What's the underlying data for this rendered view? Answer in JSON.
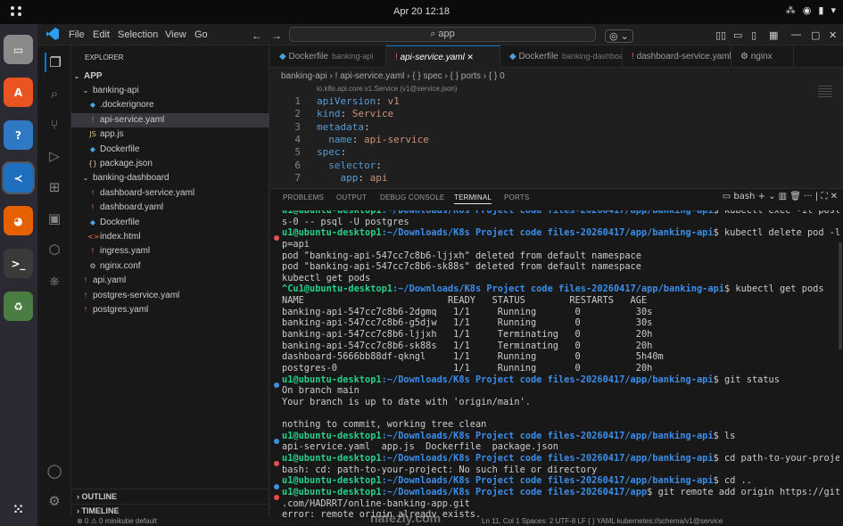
{
  "topbar": {
    "clock": "Apr 20  12:18",
    "tray": [
      "⁂",
      "◉",
      "▮",
      "▾"
    ]
  },
  "dock": [
    {
      "name": "files-icon",
      "glyph": "▭",
      "color": "#8a8a8a"
    },
    {
      "name": "app-center-icon",
      "glyph": "A",
      "color": "#e95420"
    },
    {
      "name": "help-icon",
      "glyph": "?",
      "color": "#2f78c4"
    },
    {
      "name": "vscode-icon",
      "glyph": "≺",
      "color": "#1e6fbf"
    },
    {
      "name": "firefox-icon",
      "glyph": "◕",
      "color": "#e66000"
    },
    {
      "name": "terminal-icon",
      "glyph": ">_",
      "color": "#3a3a3a"
    },
    {
      "name": "trash-icon",
      "glyph": "♻",
      "color": "#4a7d42"
    }
  ],
  "menu": [
    "File",
    "Edit",
    "Selection",
    "View",
    "Go"
  ],
  "cmd": "app",
  "explorer": {
    "title": "EXPLORER",
    "root": "APP",
    "outline": "OUTLINE",
    "timeline": "TIMELINE",
    "items": [
      {
        "label": "banking-api",
        "depth": 1,
        "icon": "⌄",
        "color": "#ccc"
      },
      {
        "label": ".dockerignore",
        "depth": 2,
        "icon": "◆",
        "color": "#4aa3df"
      },
      {
        "label": "api-service.yaml",
        "depth": 2,
        "icon": "!",
        "color": "#d35fa8",
        "sel": true
      },
      {
        "label": "app.js",
        "depth": 2,
        "icon": "JS",
        "color": "#e5c07b"
      },
      {
        "label": "Dockerfile",
        "depth": 2,
        "icon": "◆",
        "color": "#4aa3df"
      },
      {
        "label": "package.json",
        "depth": 2,
        "icon": "{}",
        "color": "#e5c07b"
      },
      {
        "label": "banking-dashboard",
        "depth": 1,
        "icon": "⌄",
        "color": "#ccc"
      },
      {
        "label": "dashboard-service.yaml",
        "depth": 2,
        "icon": "!",
        "color": "#d35fa8"
      },
      {
        "label": "dashboard.yaml",
        "depth": 2,
        "icon": "!",
        "color": "#d35fa8"
      },
      {
        "label": "Dockerfile",
        "depth": 2,
        "icon": "◆",
        "color": "#4aa3df"
      },
      {
        "label": "index.html",
        "depth": 2,
        "icon": "<>",
        "color": "#e37933"
      },
      {
        "label": "ingress.yaml",
        "depth": 2,
        "icon": "!",
        "color": "#d35fa8"
      },
      {
        "label": "nginx.conf",
        "depth": 2,
        "icon": "⚙",
        "color": "#bbb"
      },
      {
        "label": "api.yaml",
        "depth": 1,
        "icon": "!",
        "color": "#d35fa8"
      },
      {
        "label": "postgres-service.yaml",
        "depth": 1,
        "icon": "!",
        "color": "#d35fa8"
      },
      {
        "label": "postgres.yaml",
        "depth": 1,
        "icon": "!",
        "color": "#d35fa8"
      }
    ]
  },
  "tabs": [
    {
      "label": "Dockerfile",
      "desc": "banking-api",
      "active": false
    },
    {
      "label": "api-service.yaml",
      "desc": "",
      "active": true
    },
    {
      "label": "Dockerfile",
      "desc": "banking-dashboard",
      "active": false
    },
    {
      "label": "dashboard-service.yaml",
      "desc": "",
      "active": false
    },
    {
      "label": "nginx",
      "desc": "",
      "active": false
    }
  ],
  "breadcrumb": "banking-api  ›  !  api-service.yaml  ›  { } spec  ›  { } ports  ›  { } 0",
  "codelens": "io.k8s.api.core.v1.Service (v1@service.json)",
  "code": [
    {
      "n": "1",
      "k": "apiVersion",
      "v": " v1",
      "indent": ""
    },
    {
      "n": "2",
      "k": "kind",
      "v": " Service",
      "indent": ""
    },
    {
      "n": "3",
      "k": "metadata",
      "v": "",
      "indent": ""
    },
    {
      "n": "4",
      "k": "name",
      "v": " api-service",
      "indent": "  "
    },
    {
      "n": "5",
      "k": "spec",
      "v": "",
      "indent": ""
    },
    {
      "n": "6",
      "k": "selector",
      "v": "",
      "indent": "  "
    },
    {
      "n": "7",
      "k": "app",
      "v": " api",
      "indent": "    "
    }
  ],
  "panel_tabs": [
    "PROBLEMS",
    "OUTPUT",
    "DEBUG CONSOLE",
    "TERMINAL",
    "PORTS"
  ],
  "panel_tools": "▭ bash  + ⌄  ▥  🗑  ···  |  ⛶  ✕",
  "terminal": [
    {
      "type": "cmd",
      "dot": "",
      "user": "u1@ubuntu-desktop1",
      "path": ":~/Downloads/K8s Project code files-20260417/app/banking-api",
      "rest": "$ kubectl exec -it postgre"
    },
    {
      "type": "out",
      "text": "s-0 -- psql -U postgres"
    },
    {
      "type": "cmd",
      "dot": "#f14c4c",
      "user": "u1@ubuntu-desktop1",
      "path": ":~/Downloads/K8s Project code files-20260417/app/banking-api",
      "rest": "$ kubectl delete pod -l ap"
    },
    {
      "type": "out",
      "text": "p=api"
    },
    {
      "type": "out",
      "text": "pod \"banking-api-547cc7c8b6-ljjxh\" deleted from default namespace"
    },
    {
      "type": "out",
      "text": "pod \"banking-api-547cc7c8b6-sk88s\" deleted from default namespace"
    },
    {
      "type": "out",
      "text": "kubectl get pods"
    },
    {
      "type": "cmd",
      "dot": "",
      "user": "^Cu1@ubuntu-desktop1",
      "path": ":~/Downloads/K8s Project code files-20260417/app/banking-api",
      "rest": "$ kubectl get pods"
    },
    {
      "type": "out",
      "text": "NAME                          READY   STATUS        RESTARTS   AGE"
    },
    {
      "type": "out",
      "text": "banking-api-547cc7c8b6-2dgmq   1/1     Running       0          30s"
    },
    {
      "type": "out",
      "text": "banking-api-547cc7c8b6-g5djw   1/1     Running       0          30s"
    },
    {
      "type": "out",
      "text": "banking-api-547cc7c8b6-ljjxh   1/1     Terminating   0          20h"
    },
    {
      "type": "out",
      "text": "banking-api-547cc7c8b6-sk88s   1/1     Terminating   0          20h"
    },
    {
      "type": "out",
      "text": "dashboard-5666bb88df-qkngl     1/1     Running       0          5h40m"
    },
    {
      "type": "out",
      "text": "postgres-0                     1/1     Running       0          20h"
    },
    {
      "type": "cmd",
      "dot": "#3b8eea",
      "user": "u1@ubuntu-desktop1",
      "path": ":~/Downloads/K8s Project code files-20260417/app/banking-api",
      "rest": "$ git status"
    },
    {
      "type": "out",
      "text": "On branch main"
    },
    {
      "type": "out",
      "text": "Your branch is up to date with 'origin/main'."
    },
    {
      "type": "out",
      "text": ""
    },
    {
      "type": "out",
      "text": "nothing to commit, working tree clean"
    },
    {
      "type": "cmd",
      "dot": "#3b8eea",
      "user": "u1@ubuntu-desktop1",
      "path": ":~/Downloads/K8s Project code files-20260417/app/banking-api",
      "rest": "$ ls"
    },
    {
      "type": "out",
      "text": "api-service.yaml  app.js  Dockerfile  package.json"
    },
    {
      "type": "cmd",
      "dot": "#f14c4c",
      "user": "u1@ubuntu-desktop1",
      "path": ":~/Downloads/K8s Project code files-20260417/app/banking-api",
      "rest": "$ cd path-to-your-project"
    },
    {
      "type": "out",
      "text": "bash: cd: path-to-your-project: No such file or directory"
    },
    {
      "type": "cmd",
      "dot": "#3b8eea",
      "user": "u1@ubuntu-desktop1",
      "path": ":~/Downloads/K8s Project code files-20260417/app/banking-api",
      "rest": "$ cd .."
    },
    {
      "type": "cmd",
      "dot": "#f14c4c",
      "user": "u1@ubuntu-desktop1",
      "path": ":~/Downloads/K8s Project code files-20260417/app",
      "rest": "$ git remote add origin https://github"
    },
    {
      "type": "out",
      "text": ".com/HADRRT/online-banking-app.git"
    },
    {
      "type": "out",
      "text": "error: remote origin already exists."
    }
  ],
  "status": {
    "left": "⊗ 0 ⚠ 0   minikube    default",
    "right": "Ln 11, Col 1   Spaces: 2   UTF-8   LF   { } YAML   kubernetes://schema/v1@service"
  },
  "watermark": "nafezly.com"
}
